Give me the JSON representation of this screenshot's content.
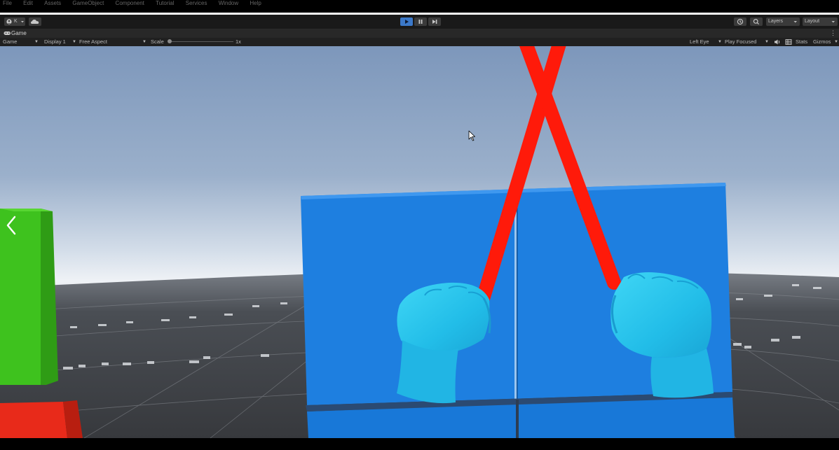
{
  "menubar": {
    "items": [
      "File",
      "Edit",
      "Assets",
      "GameObject",
      "Component",
      "Tutorial",
      "Services",
      "Window",
      "Help"
    ]
  },
  "toolbar": {
    "account_label": "K",
    "layers_label": "Layers",
    "layout_label": "Layout"
  },
  "tab": {
    "title": "Game"
  },
  "game_controls": {
    "mode_label": "Game",
    "display_label": "Display 1",
    "aspect_label": "Free Aspect",
    "scale_label": "Scale",
    "scale_value": "1x",
    "eye_label": "Left Eye",
    "play_mode_label": "Play Focused",
    "stats_label": "Stats",
    "gizmos_label": "Gizmos"
  },
  "colors": {
    "panel_blue": "#1e7fe0",
    "hand_cyan": "#27c6ee",
    "beam_red": "#ff1a0a",
    "cube_green": "#3ec21e",
    "cube_red": "#e82a1a",
    "play_active": "#3b78c8"
  },
  "icons": {
    "account": "account-icon",
    "cloud": "cloud-icon",
    "play": "play-icon",
    "pause": "pause-icon",
    "step": "step-icon",
    "history": "history-icon",
    "search": "search-icon",
    "audio": "audio-icon",
    "stats": "stats-icon",
    "cursor": "cursor-icon",
    "back": "back-arrow-icon"
  }
}
